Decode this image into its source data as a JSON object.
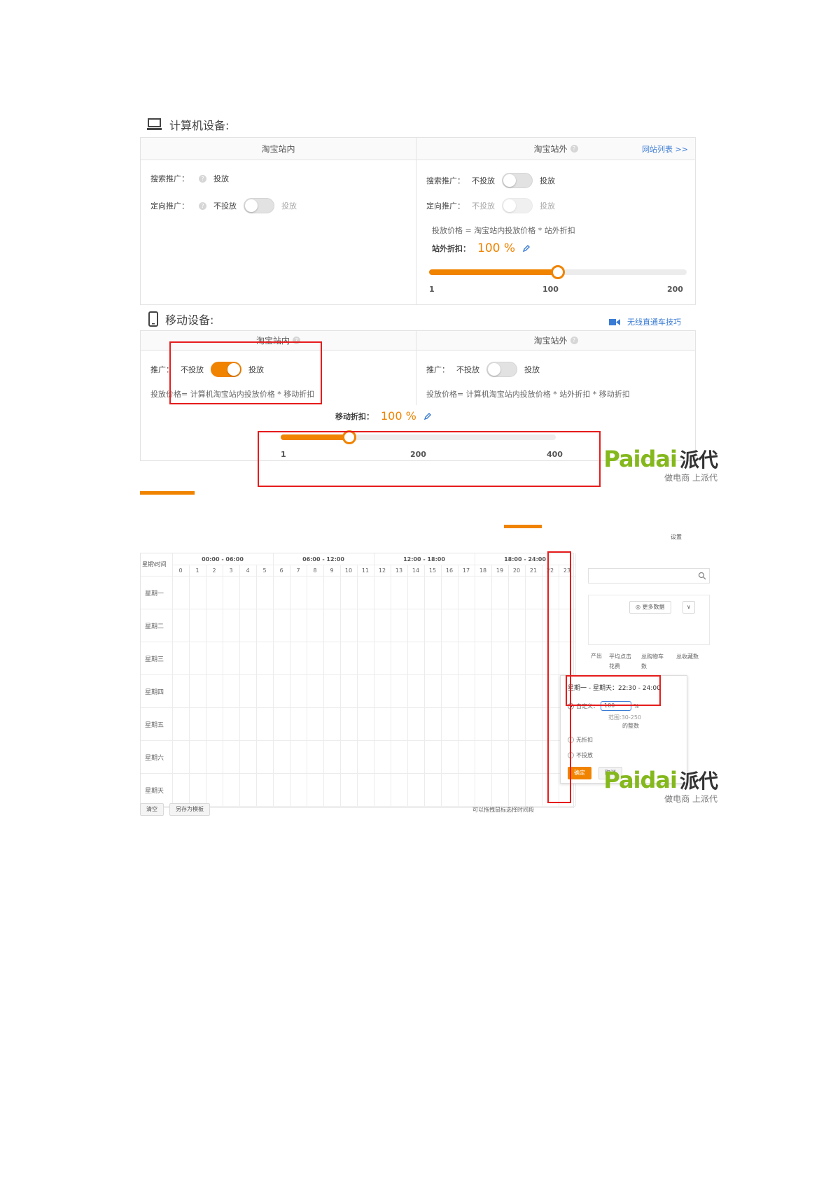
{
  "pc_section": {
    "title": "计算机设备:",
    "inner_panel": {
      "header": "淘宝站内",
      "search_label": "搜索推广：",
      "search_value": "投放",
      "targeted_label": "定向推广：",
      "targeted_off": "不投放",
      "targeted_on": "投放",
      "targeted_enabled": false
    },
    "outer_panel": {
      "header": "淘宝站外",
      "site_list_link": "网站列表 >>",
      "search_label": "搜索推广：",
      "search_off": "不投放",
      "search_on": "投放",
      "search_enabled": false,
      "targeted_label": "定向推广：",
      "targeted_off": "不投放",
      "targeted_on": "投放",
      "price_formula": "投放价格 = 淘宝站内投放价格 * 站外折扣",
      "discount_label": "站外折扣：",
      "discount_value": "100 %",
      "slider": {
        "min_label": "1",
        "mid_label": "100",
        "max_label": "200",
        "value_fraction": 0.5
      }
    }
  },
  "mobile_section": {
    "title": "移动设备:",
    "tips_link": "无线直通车技巧",
    "inner_panel": {
      "header": "淘宝站内",
      "promo_label": "推广：",
      "off_label": "不投放",
      "on_label": "投放",
      "enabled": true,
      "price_formula": "投放价格= 计算机淘宝站内投放价格 * 移动折扣"
    },
    "outer_panel": {
      "header": "淘宝站外",
      "promo_label": "推广：",
      "off_label": "不投放",
      "on_label": "投放",
      "enabled": false,
      "price_formula": "投放价格= 计算机淘宝站内投放价格 * 站外折扣 * 移动折扣"
    },
    "mobile_discount_label": "移动折扣：",
    "mobile_discount_value": "100 %",
    "slider": {
      "min_label": "1",
      "mid_label": "200",
      "max_label": "400",
      "value_fraction": 0.25
    }
  },
  "schedule": {
    "corner_label": "星期\\时间",
    "ranges": [
      "00:00 - 06:00",
      "06:00 - 12:00",
      "12:00 - 18:00",
      "18:00 - 24:00"
    ],
    "hours": [
      "0",
      "1",
      "2",
      "3",
      "4",
      "5",
      "6",
      "7",
      "8",
      "9",
      "10",
      "11",
      "12",
      "13",
      "14",
      "15",
      "16",
      "17",
      "18",
      "19",
      "20",
      "21",
      "22",
      "23"
    ],
    "days": [
      "星期一",
      "星期二",
      "星期三",
      "星期四",
      "星期五",
      "星期六",
      "星期天"
    ],
    "clear_button": "清空",
    "save_template_button": "另存为模板",
    "hint": "可以拖拽鼠标选择时间段",
    "settings_button": "设置",
    "more_data_button": "更多数据",
    "columns": [
      "产出",
      "平均点击花费",
      "总购物车数",
      "总收藏数"
    ],
    "popup": {
      "range": "星期一 - 星期天：22:30 - 24:00",
      "custom_label": "自定义：",
      "custom_value": "100",
      "percent": "%",
      "range_hint": "范围:30-250",
      "range_hint_sub": "的整数",
      "no_discount": "无折扣",
      "no_delivery": "不投放",
      "confirm": "确定",
      "cancel": "取消"
    }
  },
  "watermark": {
    "brand": "Paidai",
    "brand_cn": "派代",
    "slogan": "做电商 上派代"
  }
}
